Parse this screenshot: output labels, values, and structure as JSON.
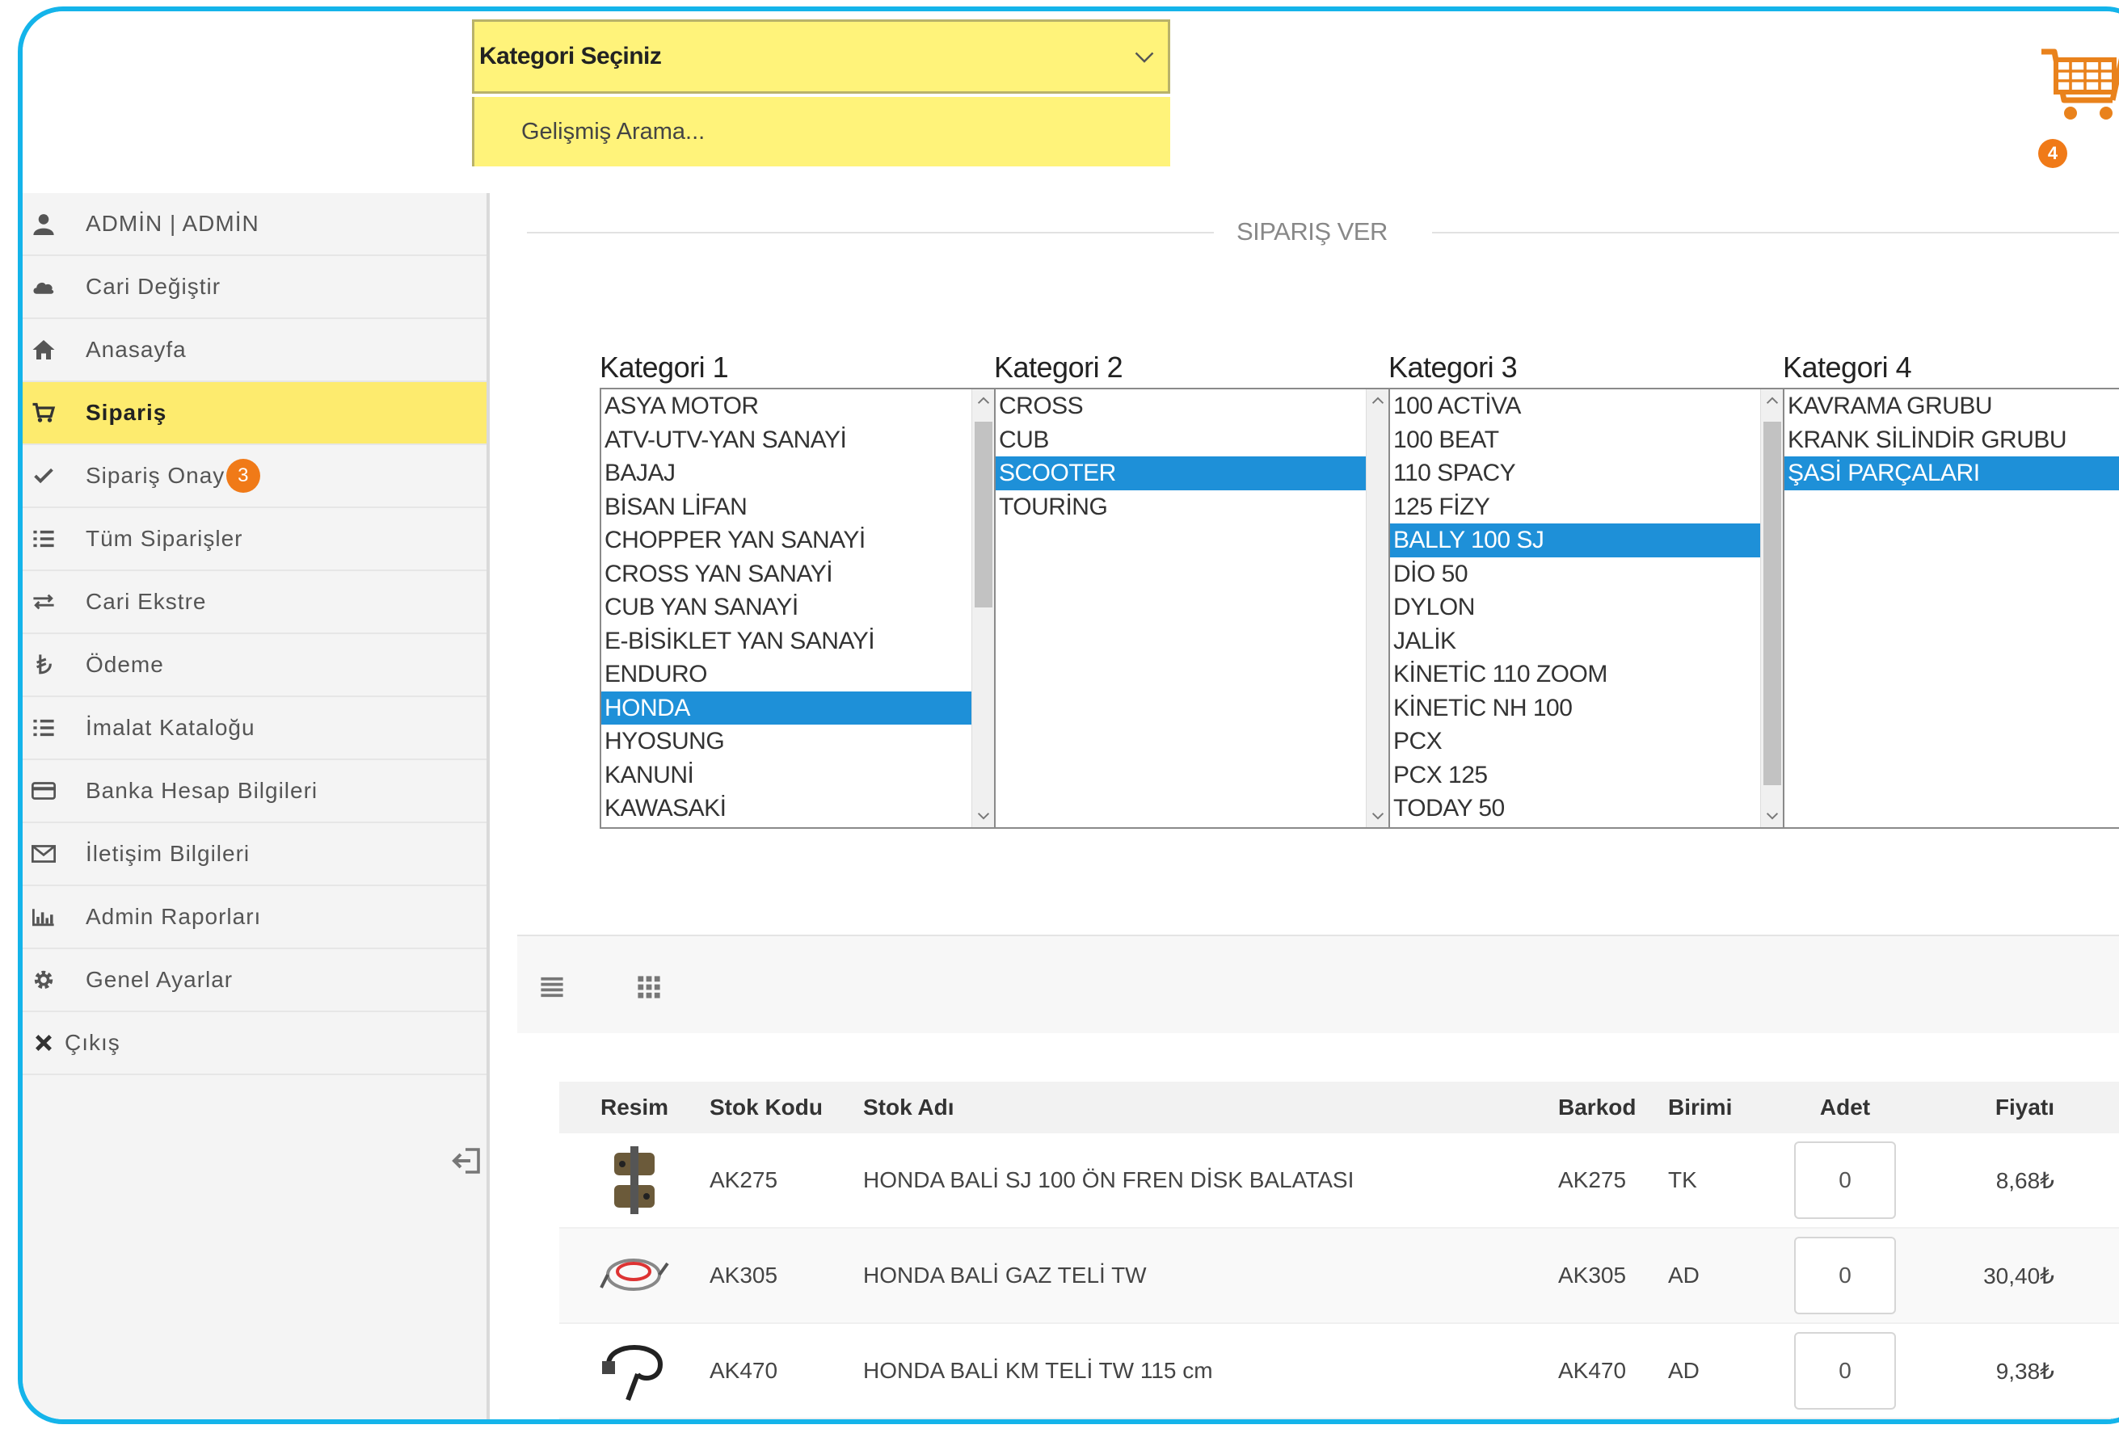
{
  "topbar": {
    "category_select": "Kategori Seçiniz",
    "advanced_search": "Gelişmiş Arama...",
    "cart_count": "4"
  },
  "sidebar": {
    "items": [
      {
        "label": "ADMİN | ADMİN",
        "icon": "user-icon"
      },
      {
        "label": "Cari Değiştir",
        "icon": "cloud-icon"
      },
      {
        "label": "Anasayfa",
        "icon": "home-icon"
      },
      {
        "label": "Sipariş",
        "icon": "cart-icon",
        "active": true
      },
      {
        "label": "Sipariş Onay",
        "icon": "check-icon",
        "badge": "3"
      },
      {
        "label": "Tüm Siparişler",
        "icon": "list-icon"
      },
      {
        "label": "Cari Ekstre",
        "icon": "exchange-icon"
      },
      {
        "label": "Ödeme",
        "icon": "lira-icon"
      },
      {
        "label": "İmalat Kataloğu",
        "icon": "list-icon"
      },
      {
        "label": "Banka Hesap Bilgileri",
        "icon": "credit-card-icon"
      },
      {
        "label": "İletişim Bilgileri",
        "icon": "envelope-icon"
      },
      {
        "label": "Admin Raporları",
        "icon": "bar-chart-icon"
      },
      {
        "label": "Genel Ayarlar",
        "icon": "gear-icon"
      },
      {
        "label": "Çıkış",
        "icon": "close-icon"
      }
    ]
  },
  "main": {
    "section_title": "SIPARIŞ VER",
    "categories": [
      {
        "label": "Kategori 1",
        "options": [
          "ASYA MOTOR",
          "ATV-UTV-YAN SANAYİ",
          "BAJAJ",
          "BİSAN LİFAN",
          "CHOPPER YAN SANAYİ",
          "CROSS YAN SANAYİ",
          "CUB YAN SANAYİ",
          "E-BİSİKLET YAN SANAYİ",
          "ENDURO",
          "HONDA",
          "HYOSUNG",
          "KANUNİ",
          "KAWASAKİ"
        ],
        "selected": "HONDA"
      },
      {
        "label": "Kategori 2",
        "options": [
          "CROSS",
          "CUB",
          "SCOOTER",
          "TOURİNG"
        ],
        "selected": "SCOOTER"
      },
      {
        "label": "Kategori 3",
        "options": [
          "100 ACTİVA",
          "100 BEAT",
          "110 SPACY",
          "125 FİZY",
          "BALLY 100 SJ",
          "DİO 50",
          "DYLON",
          "JALİK",
          "KİNETİC 110 ZOOM",
          "KİNETİC NH 100",
          "PCX",
          "PCX 125",
          "TODAY 50"
        ],
        "selected": "BALLY 100 SJ"
      },
      {
        "label": "Kategori 4",
        "options": [
          "KAVRAMA GRUBU",
          "KRANK SİLİNDİR GRUBU",
          "ŞASİ PARÇALARI"
        ],
        "selected": "ŞASİ PARÇALARI"
      }
    ],
    "table": {
      "headers": {
        "image": "Resim",
        "code": "Stok Kodu",
        "name": "Stok Adı",
        "barcode": "Barkod",
        "unit": "Birimi",
        "qty": "Adet",
        "price": "Fiyatı"
      },
      "rows": [
        {
          "code": "AK275",
          "name": "HONDA BALİ SJ 100 ÖN FREN DİSK BALATASI",
          "barcode": "AK275",
          "unit": "TK",
          "qty": "0",
          "price": "8,68₺"
        },
        {
          "code": "AK305",
          "name": "HONDA BALİ GAZ TELİ TW",
          "barcode": "AK305",
          "unit": "AD",
          "qty": "0",
          "price": "30,40₺"
        },
        {
          "code": "AK470",
          "name": "HONDA BALİ KM TELİ TW 115 cm",
          "barcode": "AK470",
          "unit": "AD",
          "qty": "0",
          "price": "9,38₺"
        }
      ]
    }
  },
  "colors": {
    "accent": "#14b4ea",
    "highlight": "#fdeb6e",
    "badge": "#f07a18",
    "selection": "#1e90d8"
  }
}
